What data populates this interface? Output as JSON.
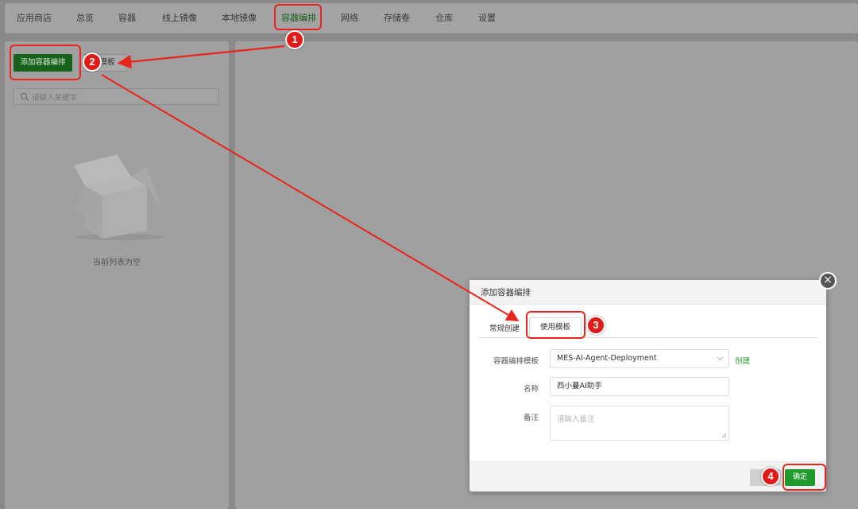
{
  "nav": {
    "tabs": [
      {
        "label": "应用商店"
      },
      {
        "label": "总览"
      },
      {
        "label": "容器"
      },
      {
        "label": "线上镜像"
      },
      {
        "label": "本地镜像"
      },
      {
        "label": "容器编排"
      },
      {
        "label": "网络"
      },
      {
        "label": "存储卷"
      },
      {
        "label": "仓库"
      },
      {
        "label": "设置"
      }
    ],
    "active_tab": "容器编排"
  },
  "left": {
    "add_label": "添加容器编排",
    "template_label": "模板",
    "search_placeholder": "请输入关键字",
    "empty_text": "当前列表为空"
  },
  "modal": {
    "title": "添加容器编排",
    "tabs": [
      "常规创建",
      "使用模板"
    ],
    "active_tab": "使用模板",
    "template_label": "容器编排模板",
    "template_value": "MES-AI-Agent-Deployment",
    "create_link": "创建",
    "name_label": "名称",
    "name_value": "西小蔓AI助手",
    "remark_label": "备注",
    "remark_placeholder": "请输入备注",
    "ok_label": "确定"
  },
  "markers": [
    "1",
    "2",
    "3",
    "4"
  ],
  "colors": {
    "annotation_red": "#e01b18",
    "primary_green": "#1f9a2c",
    "link_green": "#25a02a"
  }
}
